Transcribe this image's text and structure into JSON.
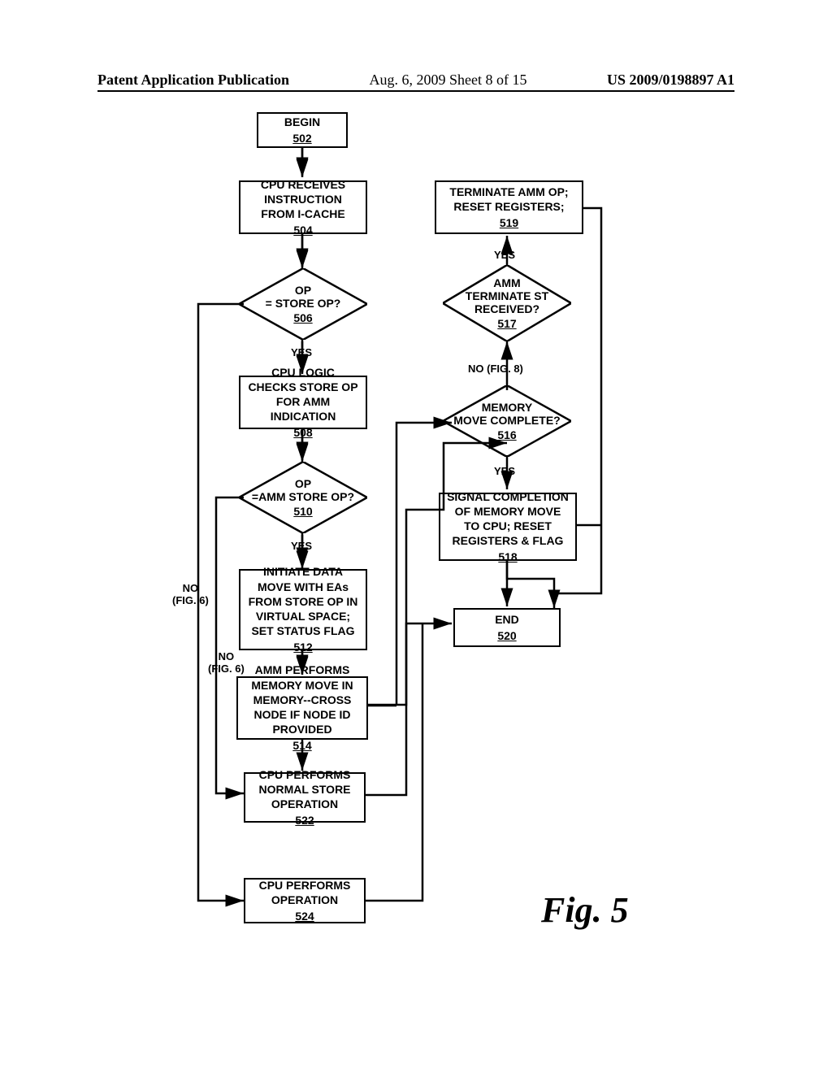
{
  "header": {
    "left": "Patent Application Publication",
    "center": "Aug. 6, 2009  Sheet 8 of 15",
    "right": "US 2009/0198897 A1"
  },
  "nodes": {
    "n502": {
      "text": "BEGIN",
      "ref": "502"
    },
    "n504": {
      "text": "CPU RECEIVES INSTRUCTION FROM I-CACHE",
      "ref": "504"
    },
    "n506": {
      "text": "OP\n= STORE OP?",
      "ref": "506"
    },
    "n508": {
      "text": "CPU LOGIC CHECKS STORE OP FOR AMM INDICATION",
      "ref": "508"
    },
    "n510": {
      "text": "OP\n=AMM STORE OP?",
      "ref": "510"
    },
    "n512": {
      "text": "INITIATE DATA MOVE WITH EAs FROM STORE OP IN VIRTUAL SPACE;\nSET STATUS FLAG",
      "ref": "512"
    },
    "n514": {
      "text": "AMM PERFORMS MEMORY MOVE IN MEMORY--CROSS NODE IF NODE ID PROVIDED",
      "ref": "514"
    },
    "n516": {
      "text": "MEMORY\nMOVE COMPLETE?",
      "ref": "516"
    },
    "n517": {
      "text": "AMM\nTERMINATE ST\nRECEIVED?",
      "ref": "517"
    },
    "n518": {
      "text": "SIGNAL COMPLETION OF MEMORY MOVE TO CPU; RESET REGISTERS & FLAG",
      "ref": "518"
    },
    "n519": {
      "text": "TERMINATE AMM OP; RESET REGISTERS;",
      "ref": "519"
    },
    "n520": {
      "text": "END",
      "ref": "520"
    },
    "n522": {
      "text": "CPU PERFORMS NORMAL STORE OPERATION",
      "ref": "522"
    },
    "n524": {
      "text": "CPU PERFORMS OPERATION",
      "ref": "524"
    }
  },
  "edge_labels": {
    "yes_506": "YES",
    "no_506": "NO\n(FIG. 6)",
    "yes_510": "YES",
    "no_510": "NO\n(FIG. 6)",
    "yes_516": "YES",
    "no_516": "NO (FIG. 8)",
    "yes_517": "YES"
  },
  "figure_label": "Fig. 5"
}
